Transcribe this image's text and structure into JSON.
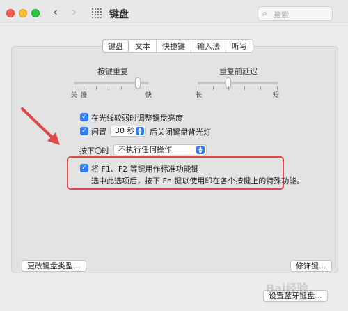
{
  "window": {
    "title": "键盘",
    "search_placeholder": "搜索"
  },
  "tabs": [
    "键盘",
    "文本",
    "快捷键",
    "输入法",
    "听写"
  ],
  "sliders": {
    "key_repeat": {
      "label": "按键重复",
      "left": "关",
      "left2": "慢",
      "right": "快"
    },
    "delay": {
      "label": "重复前延迟",
      "left": "长",
      "right": "短"
    }
  },
  "options": {
    "adjust_brightness": "在光线较弱时调整键盘亮度",
    "idle_prefix": "闲置",
    "idle_value": "30 秒",
    "idle_suffix": "后关闭键盘背光灯",
    "press_prefix": "按下",
    "press_suffix": "时",
    "press_value": "不执行任何操作",
    "fn_label": "将 F1、F2 等键用作标准功能键",
    "fn_description": "选中此选项后，按下 Fn 键以使用印在各个按键上的特殊功能。"
  },
  "buttons": {
    "change_type": "更改键盘类型...",
    "modifier": "修饰键...",
    "bluetooth": "设置蓝牙键盘..."
  },
  "watermark": "Bai经验",
  "colors": {
    "accent": "#2f7cf6",
    "highlight": "#e04848"
  }
}
